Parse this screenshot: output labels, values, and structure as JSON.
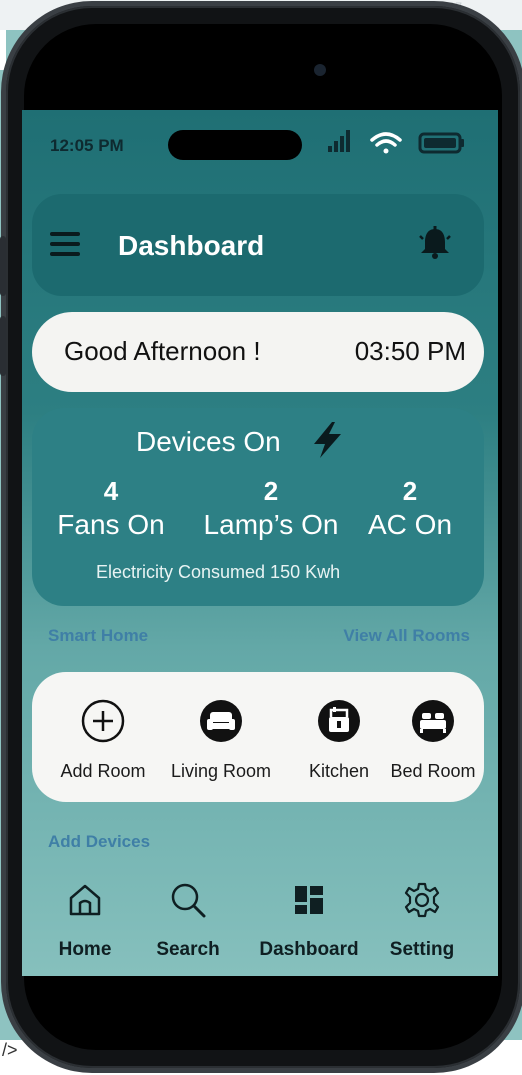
{
  "canvas": {
    "frame_label": "iPhone 16 - 17"
  },
  "status_bar": {
    "time": "12:05 PM",
    "icons": [
      "cellular-signal-icon",
      "wifi-icon",
      "battery-icon"
    ]
  },
  "header": {
    "title": "Dashboard",
    "menu_icon": "hamburger-menu-icon",
    "notification_icon": "bell-icon"
  },
  "greeting": {
    "text": "Good Afternoon !",
    "time": "03:50 PM"
  },
  "devices": {
    "title": "Devices On",
    "title_icon": "lightning-bolt-icon",
    "stats": [
      {
        "count": "4",
        "label": "Fans On"
      },
      {
        "count": "2",
        "label": "Lamp’s On"
      },
      {
        "count": "2",
        "label": "AC On"
      }
    ],
    "electricity": "Electricity Consumed 150 Kwh"
  },
  "smart_home": {
    "section_label": "Smart Home",
    "view_all": "View All Rooms",
    "rooms": [
      {
        "label": "Add Room",
        "icon": "plus-circle-icon"
      },
      {
        "label": "Living Room",
        "icon": "sofa-icon"
      },
      {
        "label": "Kitchen",
        "icon": "kitchen-icon"
      },
      {
        "label": "Bed Room",
        "icon": "bed-icon"
      }
    ]
  },
  "add_devices": "Add Devices",
  "nav": {
    "items": [
      {
        "label": "Home",
        "icon": "home-icon"
      },
      {
        "label": "Search",
        "icon": "search-icon"
      },
      {
        "label": "Dashboard",
        "icon": "dashboard-grid-icon"
      },
      {
        "label": "Setting",
        "icon": "gear-icon"
      }
    ]
  },
  "colors": {
    "accent_dark": "#1c6a6f",
    "accent_card": "#2d8085",
    "link_blue": "#3f7fa6",
    "card_light": "#f4f4f2"
  }
}
